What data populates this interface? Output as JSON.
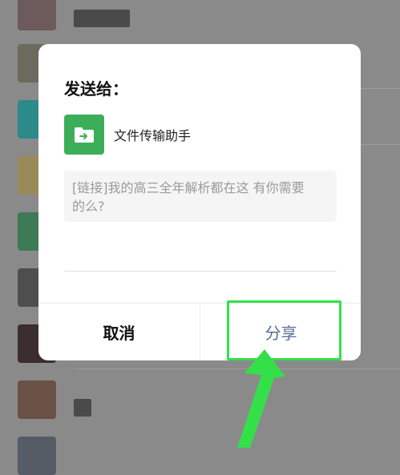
{
  "dialog": {
    "title": "发送给：",
    "recipient_name": "文件传输助手",
    "message_line1": "[链接]我的高三全年解析都在这 有你需要",
    "message_line2": "的么?",
    "cancel_label": "取消",
    "share_label": "分享"
  },
  "colors": {
    "accent_green": "#3cae5a",
    "share_text": "#576b95",
    "annotation": "#33e04a"
  },
  "icons": {
    "recipient": "folder-transfer-icon",
    "annotation": "arrow-pointer-icon"
  }
}
